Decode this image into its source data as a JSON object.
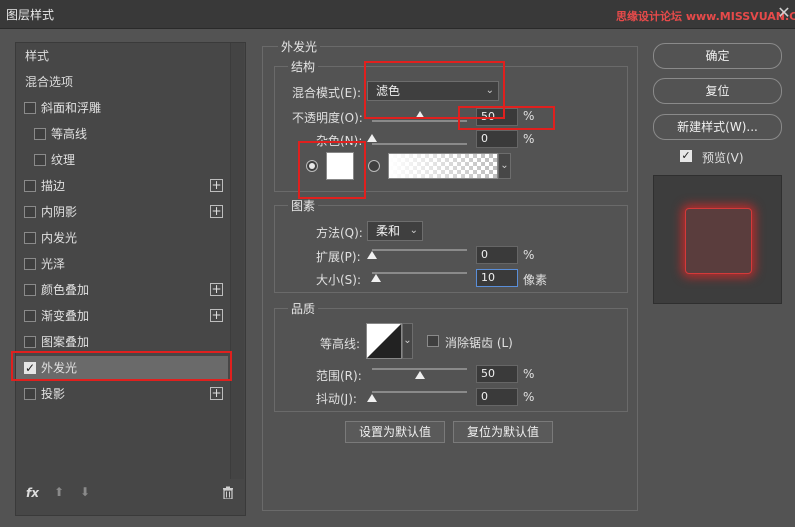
{
  "window": {
    "title": "图层样式",
    "close_glyph": "✕",
    "watermark": "思缘设计论坛 www.MISSVUAN.COM"
  },
  "left": {
    "items": [
      {
        "label": "样式",
        "type": "header"
      },
      {
        "label": "混合选项",
        "type": "header"
      },
      {
        "label": "斜面和浮雕",
        "checked": false,
        "plus": false
      },
      {
        "label": "等高线",
        "checked": false,
        "plus": false,
        "indent": true
      },
      {
        "label": "纹理",
        "checked": false,
        "plus": false,
        "indent": true
      },
      {
        "label": "描边",
        "checked": false,
        "plus": true
      },
      {
        "label": "内阴影",
        "checked": false,
        "plus": true
      },
      {
        "label": "内发光",
        "checked": false,
        "plus": false
      },
      {
        "label": "光泽",
        "checked": false,
        "plus": false
      },
      {
        "label": "颜色叠加",
        "checked": false,
        "plus": true
      },
      {
        "label": "渐变叠加",
        "checked": false,
        "plus": true
      },
      {
        "label": "图案叠加",
        "checked": false,
        "plus": false
      },
      {
        "label": "外发光",
        "checked": true,
        "plus": false,
        "selected": true
      },
      {
        "label": "投影",
        "checked": false,
        "plus": true
      }
    ],
    "fx_label": "fx"
  },
  "panel": {
    "section_title": "外发光",
    "structure": {
      "title": "结构",
      "blend_mode_label": "混合模式(E):",
      "blend_mode_value": "滤色",
      "opacity_label": "不透明度(O):",
      "opacity_value": "50",
      "opacity_pct": 0.5,
      "noise_label": "杂色(N):",
      "noise_value": "0",
      "noise_pct": 0.0,
      "unit": "%"
    },
    "elements": {
      "title": "图素",
      "method_label": "方法(Q):",
      "method_value": "柔和",
      "spread_label": "扩展(P):",
      "spread_value": "0",
      "spread_pct": 0.0,
      "size_label": "大小(S):",
      "size_value": "10",
      "size_pct": 0.04,
      "size_unit": "像素",
      "unit": "%"
    },
    "quality": {
      "title": "品质",
      "contour_label": "等高线:",
      "antialias_label": "消除锯齿 (L)",
      "range_label": "范围(R):",
      "range_value": "50",
      "range_pct": 0.5,
      "jitter_label": "抖动(J):",
      "jitter_value": "0",
      "jitter_pct": 0.0,
      "unit": "%"
    },
    "set_default": "设置为默认值",
    "reset_default": "复位为默认值"
  },
  "right": {
    "ok": "确定",
    "reset": "复位",
    "new_style": "新建样式(W)...",
    "preview_label": "预览(V)",
    "preview_checked": true
  },
  "colors": {
    "highlight_red": "#e0201e",
    "glow_color": "#c62828",
    "preview_bg": "#3d3d3d"
  }
}
